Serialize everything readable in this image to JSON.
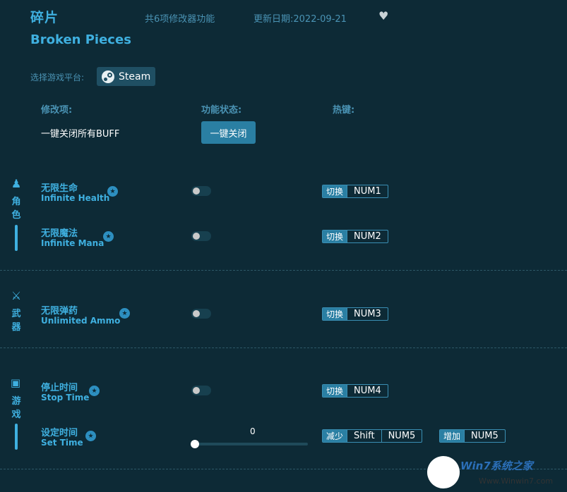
{
  "header": {
    "title_cn": "碎片",
    "title_en": "Broken Pieces",
    "feature_count": "共6项修改器功能",
    "update_date": "更新日期:2022-09-21",
    "heart_icon": "heart-icon"
  },
  "platform": {
    "label": "选择游戏平台:",
    "steam": "Steam"
  },
  "columns": {
    "mod": "修改项:",
    "status": "功能状态:",
    "hotkey": "热键:"
  },
  "buff": {
    "label": "一键关闭所有BUFF",
    "button": "一键关闭"
  },
  "categories": [
    {
      "name": "角色",
      "icon": "character-icon",
      "items": [
        {
          "cn": "无限生命",
          "en": "Infinite Health",
          "action": "切换",
          "key": "NUM1"
        },
        {
          "cn": "无限魔法",
          "en": "Infinite Mana",
          "action": "切换",
          "key": "NUM2"
        }
      ]
    },
    {
      "name": "武器",
      "icon": "crossed-swords-icon",
      "items": [
        {
          "cn": "无限弹药",
          "en": "Unlimited Ammo",
          "action": "切换",
          "key": "NUM3"
        }
      ]
    },
    {
      "name": "游戏",
      "icon": "gamepad-icon",
      "items": [
        {
          "cn": "停止时间",
          "en": "Stop Time",
          "action": "切换",
          "key": "NUM4"
        },
        {
          "cn": "设定时间",
          "en": "Set Time",
          "slider_value": "0",
          "dec_action": "减少",
          "dec_mod": "Shift",
          "dec_key": "NUM5",
          "inc_action": "增加",
          "inc_key": "NUM5"
        }
      ]
    }
  ],
  "watermark": {
    "text": "Win7系统之家",
    "url": "Www.Winwin7.com"
  }
}
